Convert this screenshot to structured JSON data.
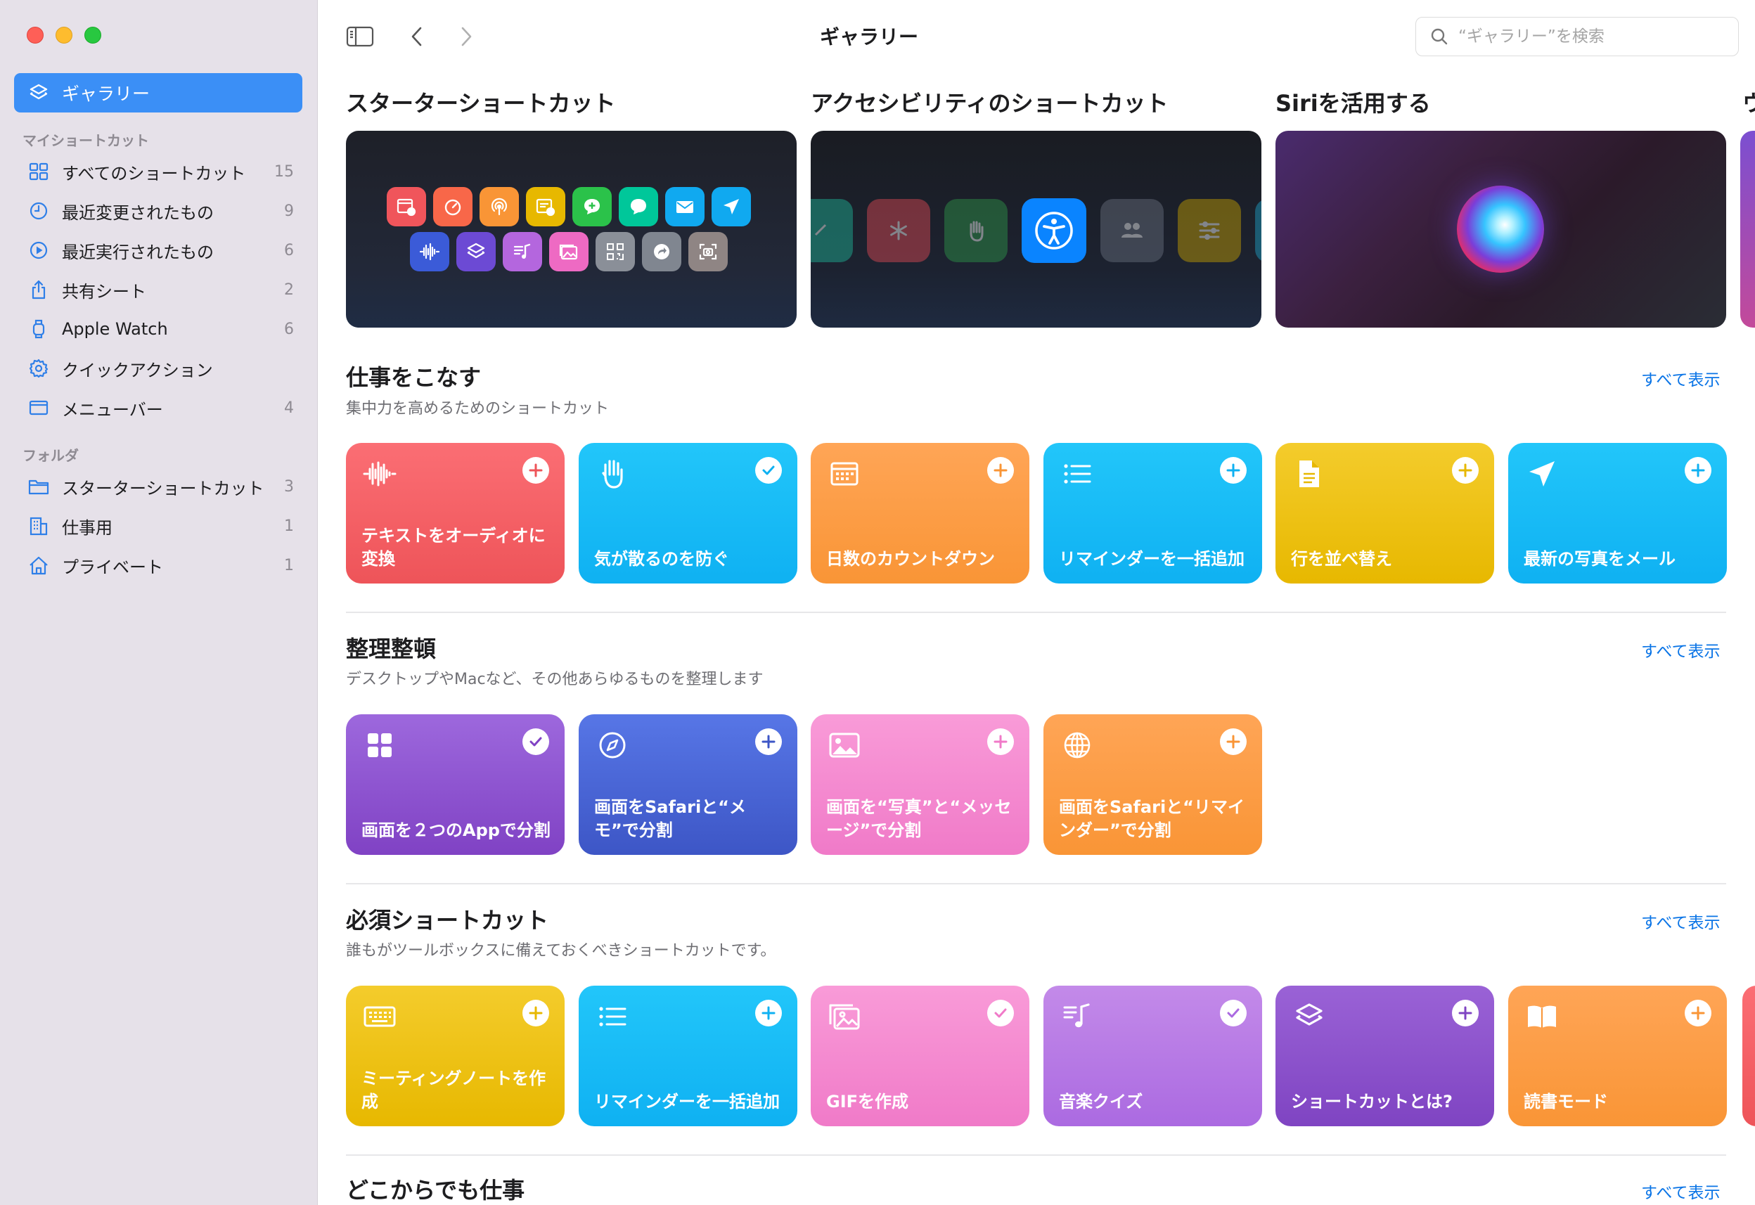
{
  "sidebar": {
    "selected": "ギャラリー",
    "section_my": "マイショートカット",
    "section_folder": "フォルダ",
    "my_items": [
      {
        "label": "すべてのショートカット",
        "count": "15",
        "icon": "grid-icon"
      },
      {
        "label": "最近変更されたもの",
        "count": "9",
        "icon": "clock-icon"
      },
      {
        "label": "最近実行されたもの",
        "count": "6",
        "icon": "play-circle-icon"
      },
      {
        "label": "共有シート",
        "count": "2",
        "icon": "share-icon"
      },
      {
        "label": "Apple Watch",
        "count": "6",
        "icon": "watch-icon"
      },
      {
        "label": "クイックアクション",
        "count": "",
        "icon": "gear-icon"
      },
      {
        "label": "メニューバー",
        "count": "4",
        "icon": "menubar-icon"
      }
    ],
    "folder_items": [
      {
        "label": "スターターショートカット",
        "count": "3",
        "icon": "folder-icon"
      },
      {
        "label": "仕事用",
        "count": "1",
        "icon": "building-icon"
      },
      {
        "label": "プライベート",
        "count": "1",
        "icon": "house-icon"
      }
    ]
  },
  "toolbar": {
    "title": "ギャラリー",
    "search_placeholder": "“ギャラリー”を検索"
  },
  "hero": [
    {
      "title": "スターターショートカット"
    },
    {
      "title": "アクセシビリティのショートカット"
    },
    {
      "title": "Siriを活用する"
    },
    {
      "title": "ウ"
    }
  ],
  "sections": [
    {
      "title": "仕事をこなす",
      "subtitle": "集中力を高めるためのショートカット",
      "see_all": "すべて表示",
      "cards": [
        {
          "title": "テキストをオーディオに変換",
          "color": "#ee5459",
          "icon": "waveform-icon",
          "action": "plus"
        },
        {
          "title": "気が散るのを防ぐ",
          "color": "#0fb1f2",
          "icon": "hand-icon",
          "action": "check"
        },
        {
          "title": "日数のカウントダウン",
          "color": "#f99536",
          "icon": "calendar-icon",
          "action": "plus"
        },
        {
          "title": "リマインダーを一括追加",
          "color": "#0fb1f2",
          "icon": "list-icon",
          "action": "plus"
        },
        {
          "title": "行を並べ替え",
          "color": "#e7b800",
          "icon": "document-icon",
          "action": "plus"
        },
        {
          "title": "最新の写真をメール",
          "color": "#0fb1f2",
          "icon": "paperplane-icon",
          "action": "plus"
        }
      ]
    },
    {
      "title": "整理整頓",
      "subtitle": "デスクトップやMacなど、その他あらゆるものを整理します",
      "see_all": "すべて表示",
      "cards": [
        {
          "title": "画面を２つのAppで分割",
          "color": "#8042c4",
          "icon": "four-squares-icon",
          "action": "check"
        },
        {
          "title": "画面をSafariと“メモ”で分割",
          "color": "#3d56c6",
          "icon": "compass-icon",
          "action": "plus"
        },
        {
          "title": "画面を“写真”と“メッセージ”で分割",
          "color": "#f07ac8",
          "icon": "photo-icon",
          "action": "plus"
        },
        {
          "title": "画面をSafariと“リマインダー”で分割",
          "color": "#f99536",
          "icon": "globe-icon",
          "action": "plus"
        }
      ]
    },
    {
      "title": "必須ショートカット",
      "subtitle": "誰もがツールボックスに備えておくべきショートカットです。",
      "see_all": "すべて表示",
      "cards": [
        {
          "title": "ミーティングノートを作成",
          "color": "#e7b800",
          "icon": "keyboard-icon",
          "action": "plus"
        },
        {
          "title": "リマインダーを一括追加",
          "color": "#0fb1f2",
          "icon": "list-icon",
          "action": "plus"
        },
        {
          "title": "GIFを作成",
          "color": "#f07ac8",
          "icon": "photos-icon",
          "action": "check"
        },
        {
          "title": "音楽クイズ",
          "color": "#ab6ae1",
          "icon": "music-list-icon",
          "action": "check"
        },
        {
          "title": "ショートカットとは?",
          "color": "#7f44c2",
          "icon": "shortcuts-icon",
          "action": "plus"
        },
        {
          "title": "読書モード",
          "color": "#f99536",
          "icon": "book-icon",
          "action": "plus"
        }
      ]
    },
    {
      "title": "どこからでも仕事",
      "see_all": "すべて表示"
    }
  ]
}
